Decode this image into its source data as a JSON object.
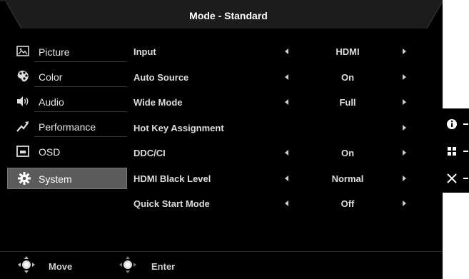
{
  "header": {
    "title": "Mode - Standard"
  },
  "sidebar": {
    "items": [
      {
        "label": "Picture",
        "icon": "picture-icon"
      },
      {
        "label": "Color",
        "icon": "palette-icon"
      },
      {
        "label": "Audio",
        "icon": "speaker-icon"
      },
      {
        "label": "Performance",
        "icon": "performance-icon"
      },
      {
        "label": "OSD",
        "icon": "osd-icon"
      },
      {
        "label": "System",
        "icon": "gear-icon",
        "selected": true
      }
    ]
  },
  "settings": [
    {
      "name": "Input",
      "value": "HDMI",
      "left_arrow": true,
      "right_arrow": true
    },
    {
      "name": "Auto Source",
      "value": "On",
      "left_arrow": true,
      "right_arrow": true
    },
    {
      "name": "Wide Mode",
      "value": "Full",
      "left_arrow": true,
      "right_arrow": true
    },
    {
      "name": "Hot Key Assignment",
      "value": "",
      "left_arrow": false,
      "right_arrow": true
    },
    {
      "name": "DDC/CI",
      "value": "On",
      "left_arrow": true,
      "right_arrow": true
    },
    {
      "name": "HDMI Black Level",
      "value": "Normal",
      "left_arrow": true,
      "right_arrow": true
    },
    {
      "name": "Quick Start Mode",
      "value": "Off",
      "left_arrow": true,
      "right_arrow": true
    }
  ],
  "footer": {
    "move_label": "Move",
    "enter_label": "Enter"
  },
  "hotkeys": [
    {
      "icon": "info-icon"
    },
    {
      "icon": "menu-grid-icon"
    },
    {
      "icon": "close-icon"
    }
  ],
  "colors": {
    "background": "#000000",
    "selected_bg": "#5b5b5b",
    "title_bar": "#1c1c1c",
    "text": "#dcdcdc"
  }
}
